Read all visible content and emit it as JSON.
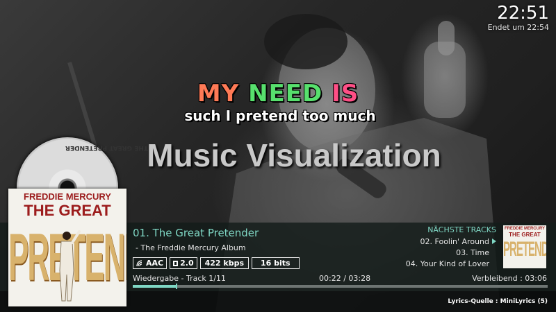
{
  "clock": {
    "time": "22:51",
    "ends_label": "Endet um 22:54"
  },
  "lyrics": {
    "line1_words": [
      "MY",
      "NEED",
      "IS"
    ],
    "line2": "such I pretend too much"
  },
  "visualization_title": "Music Visualization",
  "cd_label": "THE GREAT PRETENDER",
  "cover": {
    "artist": "FREDDIE MERCURY",
    "title": "THE GREAT",
    "big_word": "PRETENDER"
  },
  "now_playing": {
    "track_title": "01. The Great Pretender",
    "album": " - The Freddie Mercury Album",
    "codec": "AAC",
    "channels": "2.0",
    "bitrate": "422 kbps",
    "bit_depth": "16 bits",
    "playback_info": "Wiedergabe - Track 1/11",
    "elapsed_total": "00:22 / 03:28",
    "remaining": "Verbleibend : 03:06",
    "progress_fraction": 0.106
  },
  "next_tracks": {
    "heading": "NÄCHSTE TRACKS",
    "items": [
      "02. Foolin' Around",
      "03. Time",
      "04. Your Kind of Lover"
    ]
  },
  "next_thumb": {
    "artist": "FREDDIE MERCURY",
    "title": "THE GREAT",
    "big_word": "PRETENDER"
  },
  "lyrics_source": "Lyrics-Quelle : MiniLyrics (5)",
  "colors": {
    "accent": "#7fd7c4",
    "word1": "#ff7a56",
    "word2": "#57e06d",
    "word3": "#ff4f86"
  }
}
